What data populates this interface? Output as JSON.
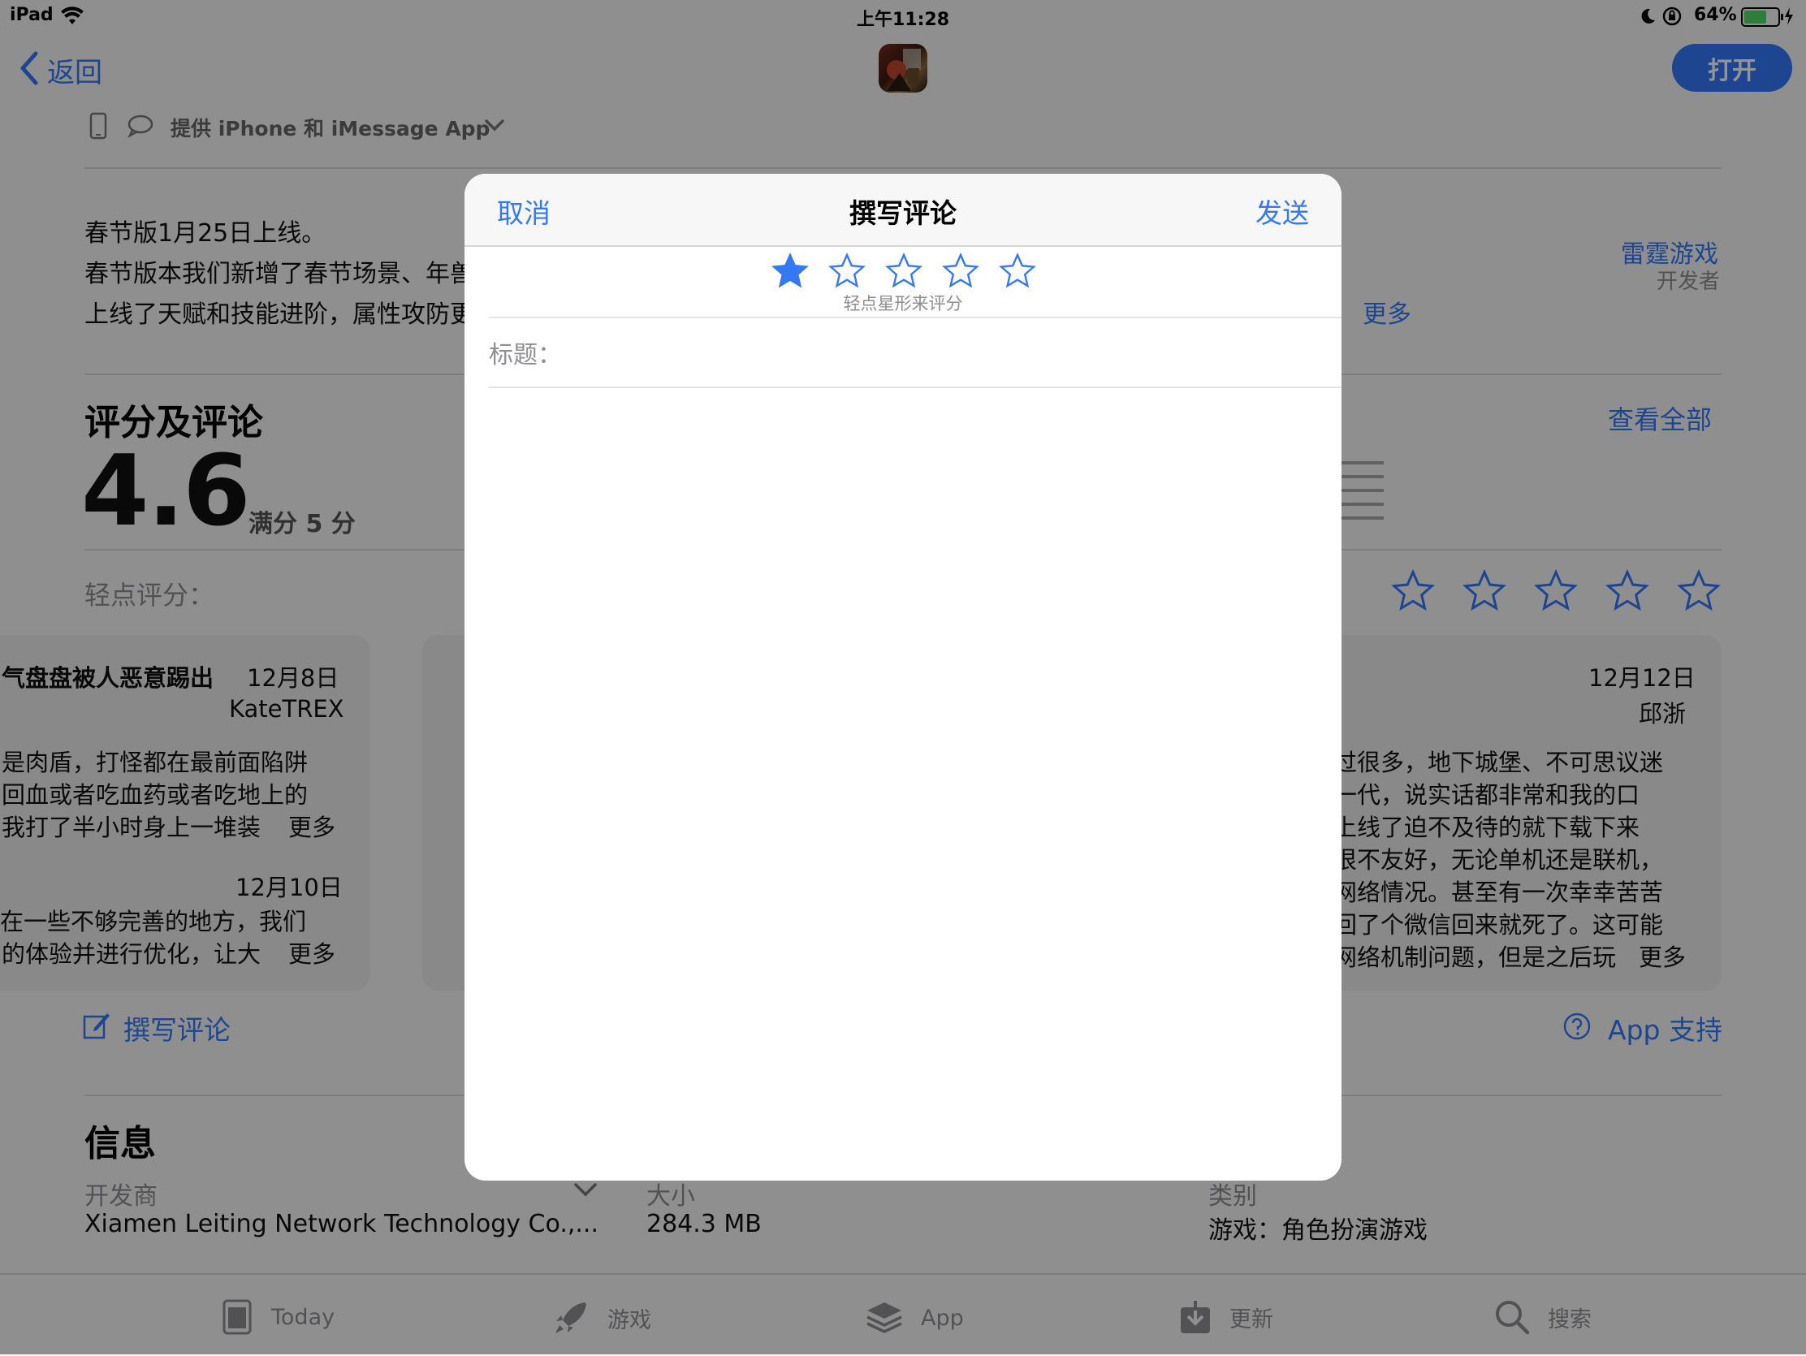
{
  "status_bar": {
    "device": "iPad",
    "time": "上午11:28",
    "battery": "64%"
  },
  "nav": {
    "back_label": "返回",
    "open_label": "打开"
  },
  "device_support": "提供 iPhone 和 iMessage App",
  "description": {
    "line1": "春节版1月25日上线。",
    "line2": "春节版本我们新增了春节场景、年兽",
    "line3": "上线了天赋和技能进阶，属性攻防更",
    "more": "更多",
    "developer_name": "雷霆游戏",
    "developer_label": "开发者"
  },
  "ratings": {
    "heading": "评分及评论",
    "see_all": "查看全部",
    "score": "4.6",
    "out_of": "满分 5 分",
    "tap_to_rate": "轻点评分："
  },
  "reviews": [
    {
      "title": "气盘盘被人恶意踢出",
      "date": "12月8日",
      "author": "KateTREX",
      "lines": [
        "是肉盾，打怪都在最前面陷阱",
        "回血或者吃血药或者吃地上的",
        "我打了半小时身上一堆装"
      ],
      "more": "更多",
      "reply_date": "12月10日",
      "reply_lines": [
        "在一些不够完善的地方，我们",
        "的体验并进行优化，让大"
      ],
      "reply_more": "更多"
    },
    {
      "date": "12月12日",
      "author": "邱浙",
      "lines": [
        "过很多，地下城堡、不可思议迷",
        "一代，说实话都非常和我的口",
        "上线了迫不及待的就下载下来",
        "很不友好，无论单机还是联机，",
        "网络情况。甚至有一次幸幸苦苦",
        "回了个微信回来就死了。这可能",
        "网络机制问题，但是之后玩"
      ],
      "more": "更多"
    }
  ],
  "actions": {
    "write_review": "撰写评论",
    "app_support": "App 支持"
  },
  "info": {
    "heading": "信息",
    "developer_label": "开发商",
    "developer_value": "Xiamen Leiting Network Technology Co.,...",
    "size_label": "大小",
    "size_value": "284.3 MB",
    "category_label": "类别",
    "category_value": "游戏：角色扮演游戏"
  },
  "tabbar": [
    {
      "label": "Today",
      "icon": "today-icon"
    },
    {
      "label": "游戏",
      "icon": "rocket-icon"
    },
    {
      "label": "App",
      "icon": "layers-icon"
    },
    {
      "label": "更新",
      "icon": "download-icon"
    },
    {
      "label": "搜索",
      "icon": "search-icon"
    }
  ],
  "modal": {
    "cancel": "取消",
    "title": "撰写评论",
    "send": "发送",
    "rating": 1,
    "rating_max": 5,
    "rating_hint": "轻点星形来评分",
    "title_label": "标题："
  },
  "colors": {
    "accent": "#3478f6",
    "overlay": "rgba(0,0,0,0.42)"
  }
}
